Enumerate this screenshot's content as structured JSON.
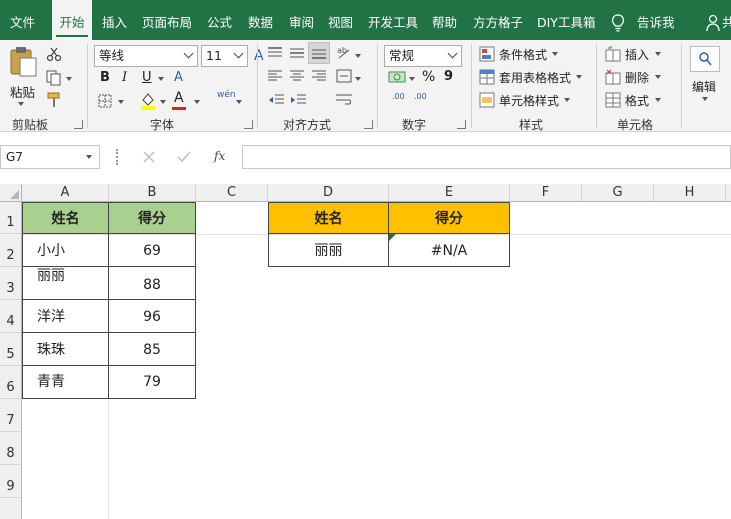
{
  "tabs": [
    {
      "label": "文件",
      "active": false
    },
    {
      "label": "开始",
      "active": true
    },
    {
      "label": "插入",
      "active": false
    },
    {
      "label": "页面布局",
      "active": false
    },
    {
      "label": "公式",
      "active": false
    },
    {
      "label": "数据",
      "active": false
    },
    {
      "label": "审阅",
      "active": false
    },
    {
      "label": "视图",
      "active": false
    },
    {
      "label": "开发工具",
      "active": false
    },
    {
      "label": "帮助",
      "active": false
    },
    {
      "label": "方方格子",
      "active": false
    },
    {
      "label": "DIY工具箱",
      "active": false
    }
  ],
  "tell_me": "告诉我",
  "share_partial": "共",
  "ribbon": {
    "clipboard": {
      "paste_label": "粘贴",
      "group_label": "剪贴板"
    },
    "font": {
      "font_name": "等线",
      "font_size": "11",
      "bold": "B",
      "italic": "I",
      "underline": "U",
      "wen_label": "wén",
      "font_color_letter": "A",
      "grow_letter": "A",
      "group_label": "字体"
    },
    "alignment": {
      "group_label": "对齐方式"
    },
    "number": {
      "format": "常规",
      "percent": "%",
      "comma": "9",
      "inc_decimal": ".00",
      "dec_decimal": ".00",
      "group_label": "数字"
    },
    "styles": {
      "conditional_label": "条件格式",
      "table_label": "套用表格格式",
      "cell_styles_label": "单元格样式",
      "group_label": "样式"
    },
    "cells": {
      "insert_label": "插入",
      "delete_label": "删除",
      "format_label": "格式",
      "group_label": "单元格"
    },
    "editing": {
      "label": "编辑"
    }
  },
  "formula_bar": {
    "name_box": "G7",
    "fx": "fx",
    "formula": ""
  },
  "columns": [
    "A",
    "B",
    "C",
    "D",
    "E",
    "F",
    "G",
    "H"
  ],
  "rows": [
    "1",
    "2",
    "3",
    "4",
    "5",
    "6",
    "7",
    "8",
    "9"
  ],
  "table_left": {
    "headers": [
      "姓名",
      "得分"
    ],
    "rows": [
      [
        "小小",
        "69"
      ],
      [
        "丽丽",
        "88"
      ],
      [
        "洋洋",
        "96"
      ],
      [
        "珠珠",
        "85"
      ],
      [
        "青青",
        "79"
      ]
    ],
    "header_color": "#a9d08e"
  },
  "table_right": {
    "headers": [
      "姓名",
      "得分"
    ],
    "row": [
      "丽丽",
      "#N/A"
    ],
    "header_color": "#ffc000"
  },
  "colors": {
    "ribbon_green": "#217346",
    "error_triangle": "#217346"
  }
}
